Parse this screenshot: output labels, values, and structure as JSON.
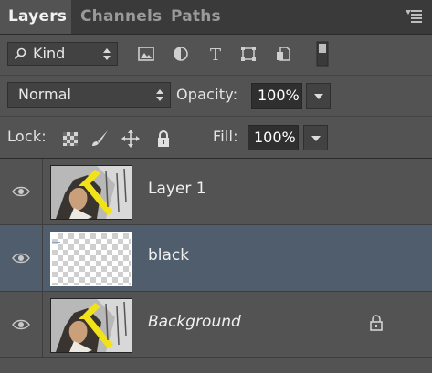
{
  "tabs": [
    {
      "label": "Layers",
      "active": true
    },
    {
      "label": "Channels",
      "active": false
    },
    {
      "label": "Paths",
      "active": false
    }
  ],
  "filter": {
    "kind_label": "Kind",
    "icons": [
      "pixel-layer-filter-icon",
      "adjustment-layer-filter-icon",
      "type-layer-filter-icon",
      "shape-layer-filter-icon",
      "smart-object-filter-icon",
      "filter-toggle-icon"
    ]
  },
  "blend": {
    "mode": "Normal",
    "opacity_label": "Opacity:",
    "opacity_value": "100%"
  },
  "lock": {
    "label": "Lock:",
    "icons": [
      "lock-transparent-pixels-icon",
      "lock-image-pixels-icon",
      "lock-position-icon",
      "lock-all-icon"
    ],
    "fill_label": "Fill:",
    "fill_value": "100%"
  },
  "layers": [
    {
      "name": "Layer 1",
      "thumbnail": "painting",
      "selected": false,
      "locked": false,
      "italic": false
    },
    {
      "name": "black",
      "thumbnail": "transparent",
      "selected": true,
      "locked": false,
      "italic": false
    },
    {
      "name": "Background",
      "thumbnail": "painting",
      "selected": false,
      "locked": true,
      "italic": true
    }
  ],
  "colors": {
    "panel_bg": "#535353",
    "tabbar_bg": "#3a3a3a",
    "selected_row": "#4f5d6d",
    "field_bg": "#2f2f2f"
  }
}
